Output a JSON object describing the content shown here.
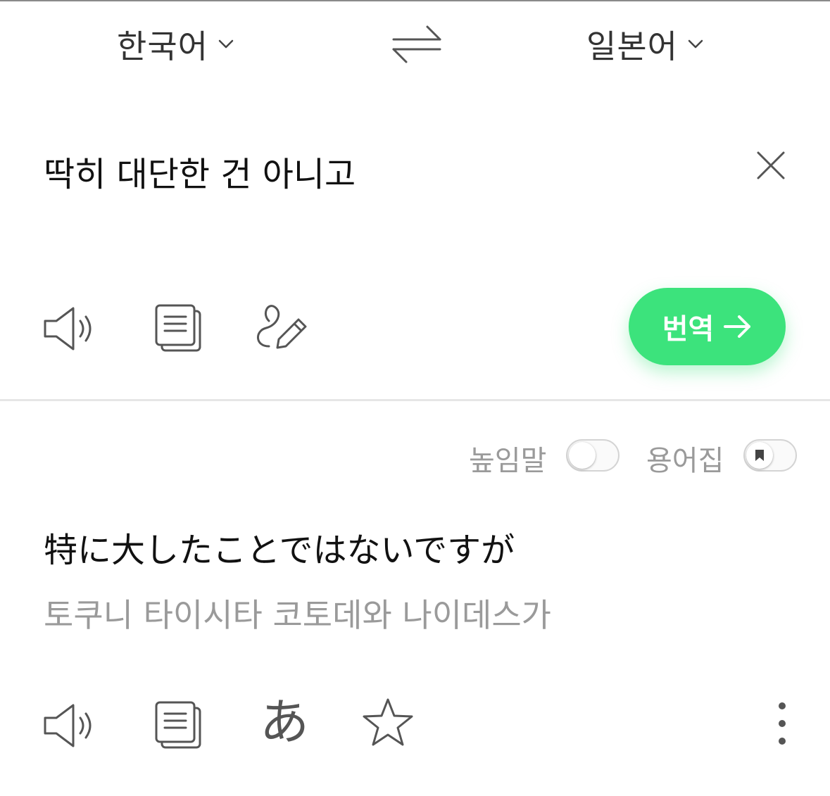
{
  "header": {
    "source_language": "한국어",
    "target_language": "일본어"
  },
  "source": {
    "text": "딱히 대단한 건 아니고",
    "translate_button_label": "번역"
  },
  "result": {
    "options": {
      "honorific_label": "높임말",
      "honorific_on": false,
      "glossary_label": "용어집",
      "glossary_on": false
    },
    "translated_text": "特に大したことではないですが",
    "pronunciation": "토쿠니 타이시타 코토데와 나이데스가",
    "kana_glyph": "あ"
  },
  "icons": {
    "swap": "swap-arrows-icon",
    "clear": "close-icon",
    "speaker": "speaker-icon",
    "copy": "copy-icon",
    "handwriting": "handwriting-pen-icon",
    "kana": "kana-icon",
    "favorite": "star-icon",
    "more": "more-vertical-icon",
    "arrow": "arrow-right-icon",
    "bookmark": "bookmark-icon"
  },
  "colors": {
    "accent": "#3ce37c",
    "muted_text": "#9a9a9a",
    "icon_stroke": "#555555"
  }
}
